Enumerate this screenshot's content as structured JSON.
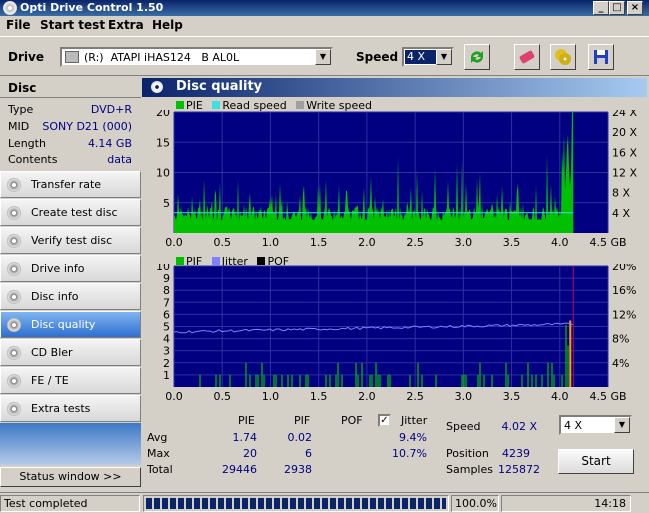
{
  "window": {
    "title": "Opti Drive Control 1.50"
  },
  "menu": [
    "File",
    "Start test",
    "Extra",
    "Help"
  ],
  "toolbar": {
    "drive_label": "Drive",
    "drive_value": "(R:)  ATAPI iHAS124   B AL0L",
    "speed_label": "Speed",
    "speed_value": "4 X"
  },
  "disc": {
    "header": "Disc",
    "rows": [
      {
        "k": "Type",
        "v": "DVD+R"
      },
      {
        "k": "MID",
        "v": "SONY D21 (000)"
      },
      {
        "k": "Length",
        "v": "4.14 GB"
      },
      {
        "k": "Contents",
        "v": "data"
      }
    ]
  },
  "nav": [
    {
      "label": "Transfer rate",
      "active": false
    },
    {
      "label": "Create test disc",
      "active": false
    },
    {
      "label": "Verify test disc",
      "active": false
    },
    {
      "label": "Drive info",
      "active": false
    },
    {
      "label": "Disc info",
      "active": false
    },
    {
      "label": "Disc quality",
      "active": true
    },
    {
      "label": "CD Bler",
      "active": false
    },
    {
      "label": "FE / TE",
      "active": false
    },
    {
      "label": "Extra tests",
      "active": false
    }
  ],
  "status_window_label": "Status window >>",
  "panel_title": "Disc quality",
  "chart_data": [
    {
      "type": "bar",
      "legend": [
        "PIE",
        "Read speed",
        "Write speed"
      ],
      "colors": {
        "PIE": "#00c000",
        "Read speed": "#40e0e0",
        "Write speed": "#a0a0a0",
        "background": "#000080",
        "grid": "#3030a0"
      },
      "x_ticks": [
        "0.0",
        "0.5",
        "1.0",
        "1.5",
        "2.0",
        "2.5",
        "3.0",
        "3.5",
        "4.0",
        "4.5 GB"
      ],
      "xlim": [
        0,
        4.5
      ],
      "y_left_ticks": [
        "5",
        "10",
        "15",
        "20"
      ],
      "ylim": [
        0,
        20
      ],
      "y_right_ticks": [
        "4 X",
        "8 X",
        "12 X",
        "16 X",
        "20 X",
        "24 X"
      ],
      "y_right_lim": [
        0,
        24
      ],
      "read_speed_x": 4.02,
      "x_end": 4.14
    },
    {
      "type": "bar",
      "legend": [
        "PIF",
        "Jitter",
        "POF"
      ],
      "colors": {
        "PIF": "#00c000",
        "Jitter": "#8080ff",
        "POF": "#000000",
        "background": "#000080",
        "grid": "#3030a0"
      },
      "x_ticks": [
        "0.0",
        "0.5",
        "1.0",
        "1.5",
        "2.0",
        "2.5",
        "3.0",
        "3.5",
        "4.0",
        "4.5 GB"
      ],
      "xlim": [
        0,
        4.5
      ],
      "y_left_ticks": [
        "1",
        "2",
        "3",
        "4",
        "5",
        "6",
        "7",
        "8",
        "9",
        "10"
      ],
      "ylim": [
        0,
        10
      ],
      "y_right_ticks": [
        "4%",
        "8%",
        "12%",
        "16%",
        "20%"
      ],
      "y_right_lim": [
        0,
        20
      ],
      "x_end": 4.14
    }
  ],
  "stats": {
    "headers": {
      "pie": "PIE",
      "pif": "PIF",
      "pof": "POF",
      "jitter": "Jitter"
    },
    "rows": [
      {
        "label": "Avg",
        "pie": "1.74",
        "pif": "0.02",
        "jitter": "9.4%"
      },
      {
        "label": "Max",
        "pie": "20",
        "pif": "6",
        "jitter": "10.7%"
      },
      {
        "label": "Total",
        "pie": "29446",
        "pif": "2938"
      }
    ],
    "speed_label": "Speed",
    "speed_value": "4.02 X",
    "position_label": "Position",
    "position_value": "4239",
    "samples_label": "Samples",
    "samples_value": "125872",
    "speed_select": "4 X",
    "start_label": "Start"
  },
  "statusbar": {
    "text": "Test completed",
    "progress": "100.0%",
    "progress_fraction": 1.0,
    "time": "14:18"
  }
}
